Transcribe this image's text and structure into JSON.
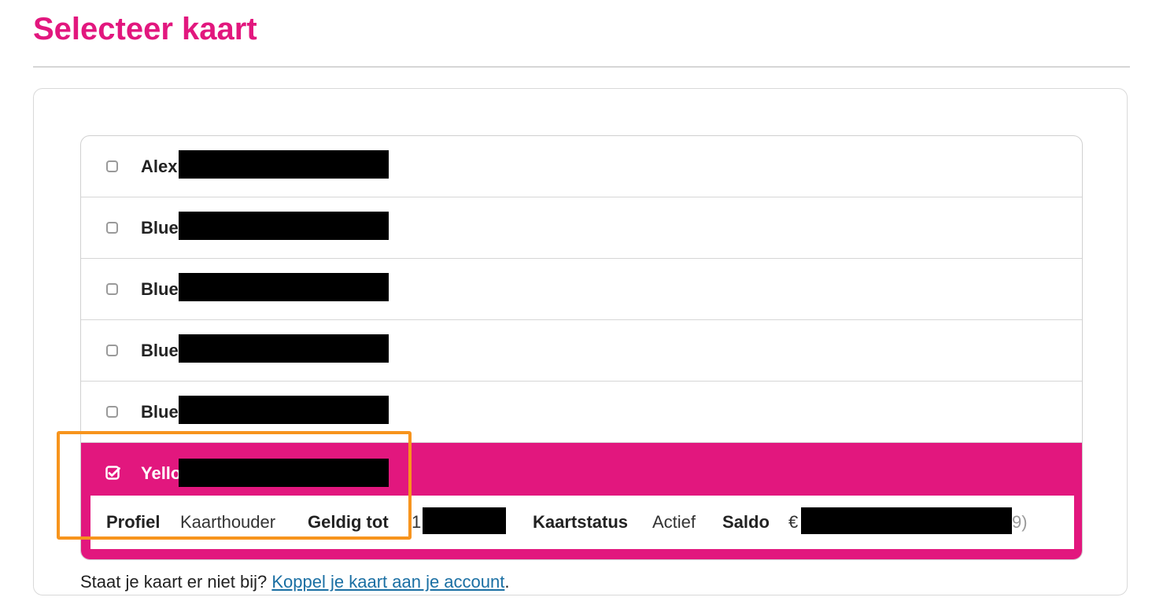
{
  "colors": {
    "brand_pink": "#e2177e",
    "highlight_orange": "#f7941d",
    "link_blue": "#1a6fa3"
  },
  "page": {
    "title": "Selecteer kaart"
  },
  "cards": [
    {
      "name": "Alex",
      "selected": false
    },
    {
      "name": "Blue",
      "selected": false
    },
    {
      "name": "Blue",
      "selected": false,
      "trailing_fragment": "/"
    },
    {
      "name": "Blue",
      "selected": false,
      "trailing_fragment": ")"
    },
    {
      "name": "Blue",
      "selected": false
    },
    {
      "name": "Yello",
      "selected": true
    }
  ],
  "selected_card": {
    "profile_label": "Profiel",
    "profile_value": "Kaarthouder",
    "valid_until_label": "Geldig tot",
    "valid_until_value_fragment": "1",
    "status_label": "Kaartstatus",
    "status_value": "Actief",
    "balance_label": "Saldo",
    "balance_prefix": "€",
    "balance_suffix_fragment": "9)"
  },
  "icons": {
    "unchecked": "checkbox-unchecked-icon",
    "checked": "checkbox-checked-icon"
  },
  "footer": {
    "question": "Staat je kaart er niet bij?",
    "link_label": "Koppel je kaart aan je account",
    "trailing": "."
  }
}
